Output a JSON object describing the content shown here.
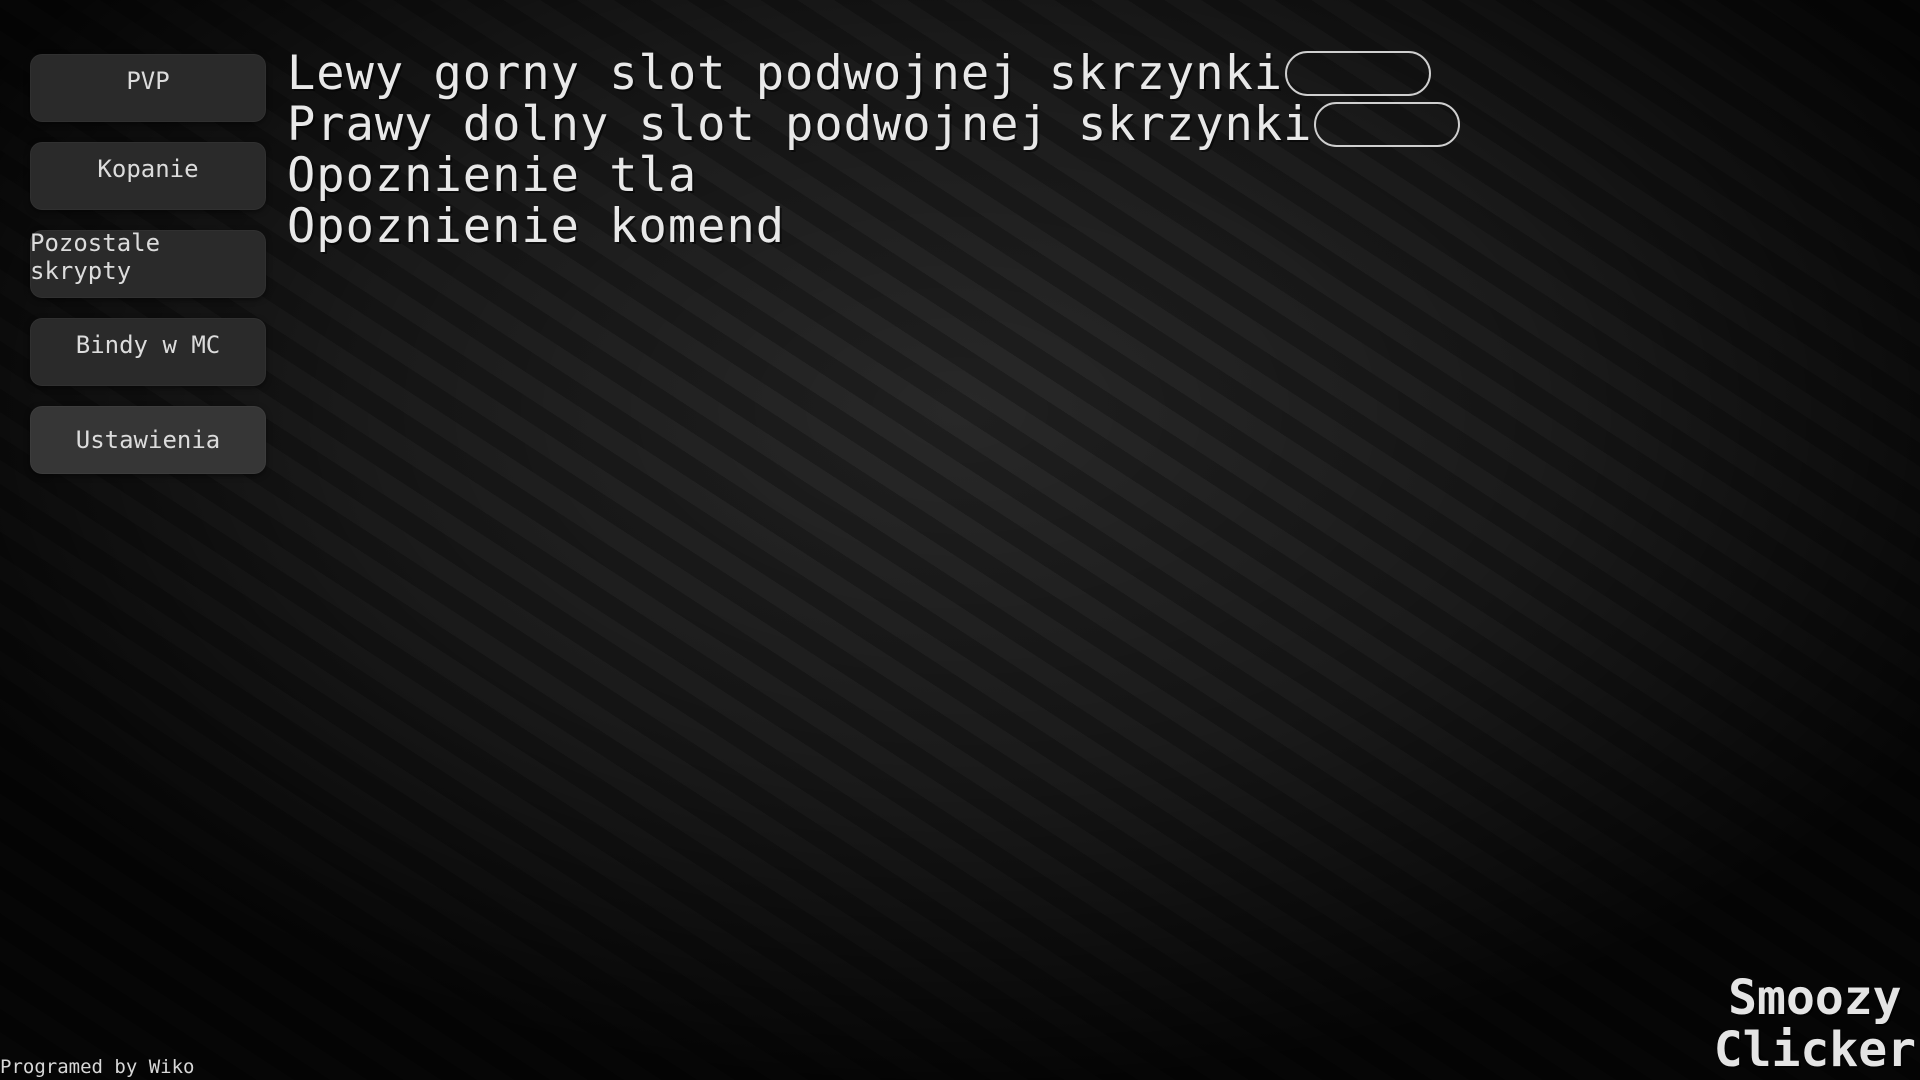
{
  "sidebar": {
    "items": [
      {
        "label": "PVP"
      },
      {
        "label": "Kopanie"
      },
      {
        "label": "Pozostale skrypty"
      },
      {
        "label": "Bindy w MC"
      },
      {
        "label": "Ustawienia"
      }
    ]
  },
  "settings": {
    "rows": [
      {
        "label": "Lewy gorny slot podwojnej skrzynki",
        "value": ""
      },
      {
        "label": "Prawy dolny slot podwojnej skrzynki",
        "value": ""
      },
      {
        "label": "Opoznienie tla"
      },
      {
        "label": "Opoznienie komend"
      }
    ]
  },
  "footer": {
    "credit": "Programed by Wiko"
  },
  "brand": {
    "line1": "Smoozy",
    "line2": "Clicker"
  }
}
